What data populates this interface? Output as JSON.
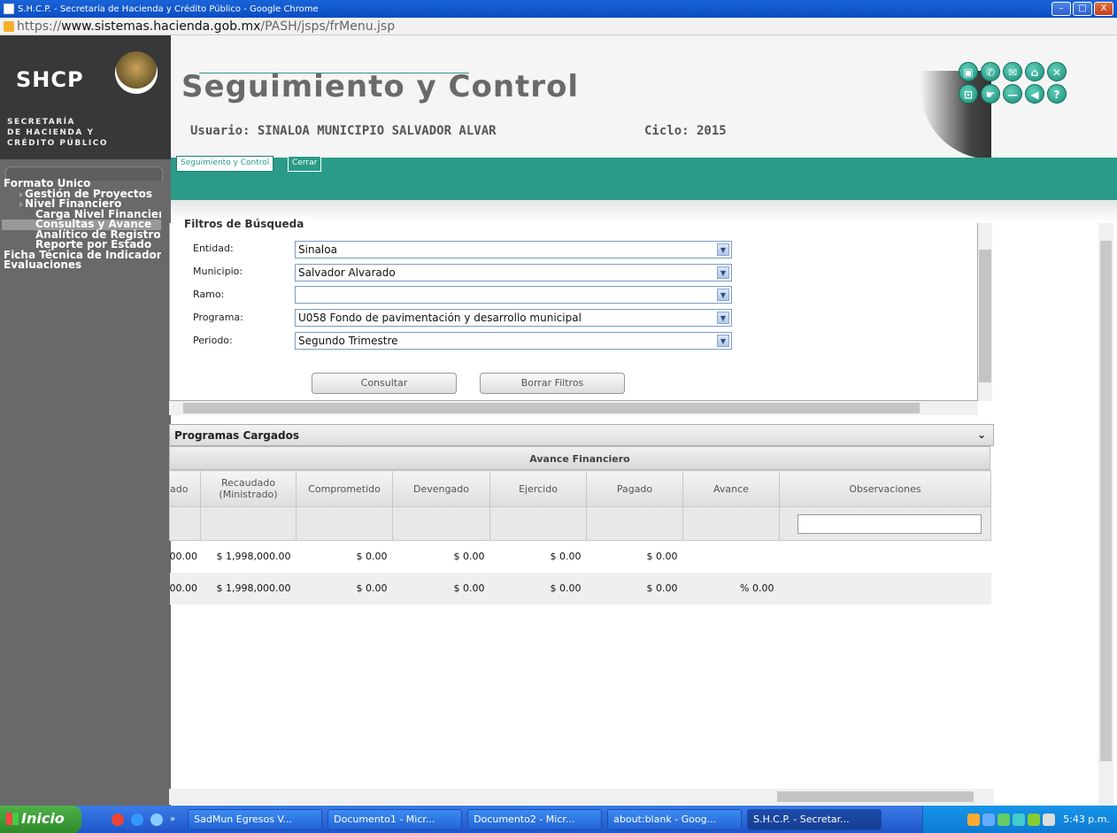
{
  "window": {
    "title": "S.H.C.P. - Secretaría de Hacienda y Crédito Público - Google Chrome"
  },
  "address": {
    "scheme": "https://",
    "domain": "www.sistemas.hacienda.gob.mx",
    "path": "/PASH/jsps/frMenu.jsp"
  },
  "brand": {
    "short": "SHCP",
    "line1": "SECRETARÍA",
    "line2": "DE HACIENDA Y",
    "line3": "CRÉDITO PÚBLICO"
  },
  "app": {
    "title": "Seguimiento y Control",
    "usuario": "Usuario: SINALOA MUNICIPIO SALVADOR ALVAR",
    "ciclo": "Ciclo: 2015"
  },
  "header_icons": [
    "printer-icon",
    "phone-icon",
    "mail-icon",
    "home-icon",
    "close-icon",
    "lock-icon",
    "hand-icon",
    "minus-icon",
    "back-icon",
    "help-icon"
  ],
  "nav": {
    "tab1": "Seguimiento y Control",
    "tab2": "Cerrar"
  },
  "menu": {
    "formato": "Formato Único",
    "gestion": "Gestión de Proyectos",
    "nivel": "Nivel Financiero",
    "carga": "Carga Nivel Financiero",
    "consultas": "Consultas y Avance",
    "analitico": "Analítico de Registro",
    "reporte": "Reporte por Estado",
    "ficha": "Ficha Técnica de Indicadores",
    "evaluaciones": "Evaluaciones"
  },
  "filters": {
    "title": "Filtros de Búsqueda",
    "entidad_label": "Entidad:",
    "entidad": "Sinaloa",
    "municipio_label": "Municipio:",
    "municipio": "Salvador Alvarado",
    "ramo_label": "Ramo:",
    "ramo": "",
    "programa_label": "Programa:",
    "programa": "U058 Fondo de pavimentación y desarrollo municipal",
    "periodo_label": "Periodo:",
    "periodo": "Segundo Trimestre",
    "consultar": "Consultar",
    "borrar": "Borrar Filtros"
  },
  "programas": {
    "title": "Programas Cargados",
    "group_header": "Avance Financiero",
    "columns": [
      "ado",
      "Recaudado (Ministrado)",
      "Comprometido",
      "Devengado",
      "Ejercido",
      "Pagado",
      "Avance",
      "Observaciones"
    ],
    "rows": [
      [
        "00.00",
        "$ 1,998,000.00",
        "$ 0.00",
        "$ 0.00",
        "$ 0.00",
        "$ 0.00",
        "",
        ""
      ],
      [
        "00.00",
        "$ 1,998,000.00",
        "$ 0.00",
        "$ 0.00",
        "$ 0.00",
        "$ 0.00",
        "% 0.00",
        ""
      ]
    ]
  },
  "taskbar": {
    "start": "Inicio",
    "chevron": "»",
    "tasks": [
      "SadMun Egresos V...",
      "Documento1 - Micr...",
      "Documento2 - Micr...",
      "about:blank - Goog...",
      "S.H.C.P. - Secretar..."
    ],
    "clock": "5:43 p.m."
  }
}
